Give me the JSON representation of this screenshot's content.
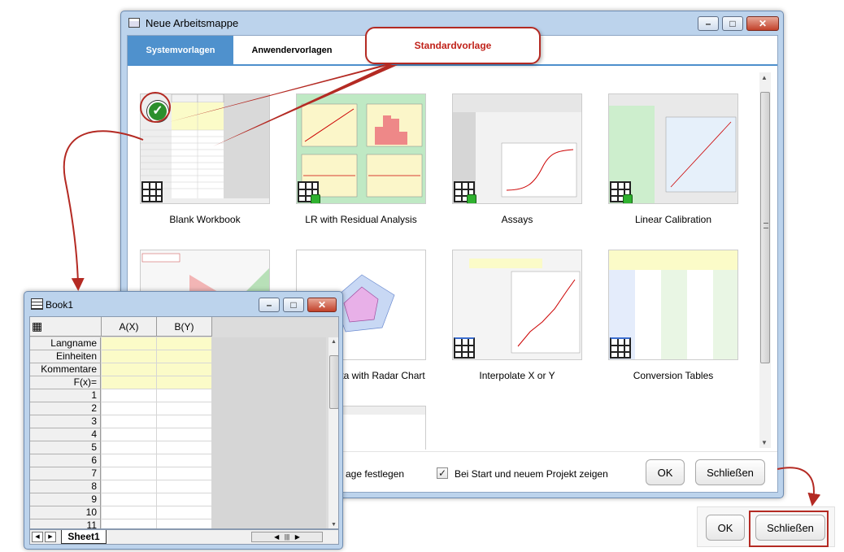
{
  "dialog": {
    "title": "Neue Arbeitsmappe",
    "tabs": [
      "Systemvorlagen",
      "Anwendervorlagen"
    ],
    "templates": [
      {
        "name": "Blank Workbook"
      },
      {
        "name": "LR with Residual Analysis"
      },
      {
        "name": "Assays"
      },
      {
        "name": "Linear Calibration"
      },
      {
        "name": ""
      },
      {
        "name": "Data with Radar Chart"
      },
      {
        "name": "Interpolate X or Y"
      },
      {
        "name": "Conversion Tables"
      }
    ],
    "set_default_partial": "age festlegen",
    "show_on_start_label": "Bei Start und neuem Projekt zeigen",
    "show_on_start_checked": true,
    "ok_label": "OK",
    "close_label": "Schließen"
  },
  "callout": {
    "text": "Standardvorlage"
  },
  "book": {
    "title": "Book1",
    "columns": [
      "A(X)",
      "B(Y)"
    ],
    "meta_rows": [
      "Langname",
      "Einheiten",
      "Kommentare",
      "F(x)="
    ],
    "rows": [
      "1",
      "2",
      "3",
      "4",
      "5",
      "6",
      "7",
      "8",
      "9",
      "10",
      "11"
    ],
    "sheet_tab": "Sheet1"
  },
  "zoomed": {
    "ok_label": "OK",
    "close_label": "Schließen"
  },
  "colors": {
    "accent": "#4f91cd",
    "callout_red": "#b42a23",
    "meta_cell": "#fbfbc8"
  }
}
